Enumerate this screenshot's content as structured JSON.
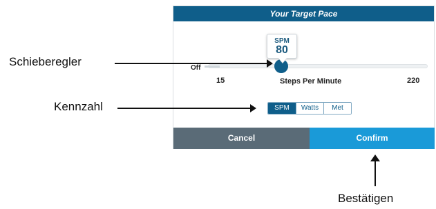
{
  "dialog": {
    "title": "Your Target Pace",
    "slider": {
      "unit": "SPM",
      "value": "80",
      "off_label": "Off",
      "min_label": "15",
      "max_label": "220",
      "axis_label": "Steps Per Minute",
      "min": 15,
      "max": 220,
      "current": 80
    },
    "metric_options": [
      "SPM",
      "Watts",
      "Met"
    ],
    "selected_metric": "SPM",
    "cancel_label": "Cancel",
    "confirm_label": "Confirm"
  },
  "annotations": {
    "slider_callout": "Schieberegler",
    "metric_callout": "Kennzahl",
    "confirm_callout": "Bestätigen"
  },
  "colors": {
    "header": "#0f5e8a",
    "thumb": "#0f5e8a",
    "cancel": "#5a6b77",
    "confirm": "#1a9ad8"
  }
}
